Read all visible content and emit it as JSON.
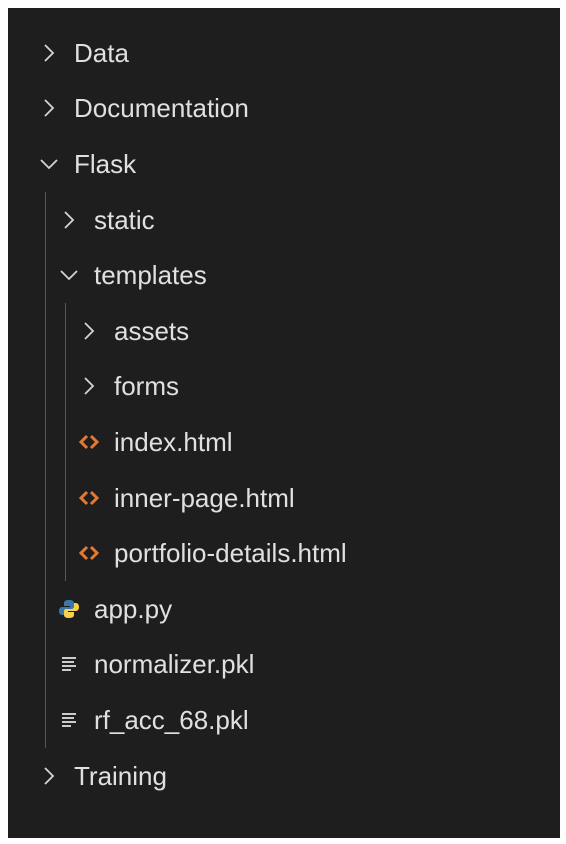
{
  "explorer": {
    "items": [
      {
        "label": "Data",
        "kind": "folder",
        "state": "collapsed",
        "depth": 0
      },
      {
        "label": "Documentation",
        "kind": "folder",
        "state": "collapsed",
        "depth": 0
      },
      {
        "label": "Flask",
        "kind": "folder",
        "state": "expanded",
        "depth": 0
      },
      {
        "label": "static",
        "kind": "folder",
        "state": "collapsed",
        "depth": 1
      },
      {
        "label": "templates",
        "kind": "folder",
        "state": "expanded",
        "depth": 1
      },
      {
        "label": "assets",
        "kind": "folder",
        "state": "collapsed",
        "depth": 2
      },
      {
        "label": "forms",
        "kind": "folder",
        "state": "collapsed",
        "depth": 2
      },
      {
        "label": "index.html",
        "kind": "html-file",
        "depth": 2
      },
      {
        "label": "inner-page.html",
        "kind": "html-file",
        "depth": 2
      },
      {
        "label": "portfolio-details.html",
        "kind": "html-file",
        "depth": 2
      },
      {
        "label": "app.py",
        "kind": "python-file",
        "depth": 1
      },
      {
        "label": "normalizer.pkl",
        "kind": "text-file",
        "depth": 1
      },
      {
        "label": "rf_acc_68.pkl",
        "kind": "text-file",
        "depth": 1
      },
      {
        "label": "Training",
        "kind": "folder",
        "state": "collapsed",
        "depth": 0
      }
    ]
  },
  "colors": {
    "background": "#1e1e1e",
    "text": "#e0e0e0",
    "chevron": "#d4d4d4",
    "html_icon": "#e37933",
    "python_icon_blue": "#3b78a8",
    "python_icon_yellow": "#f7d04c",
    "text_file_icon": "#cccccc",
    "indent_guide": "#585858"
  },
  "icons": {
    "chevron-right": "chevron-right-icon",
    "chevron-down": "chevron-down-icon",
    "html": "html-file-icon",
    "python": "python-file-icon",
    "text": "text-file-icon"
  }
}
